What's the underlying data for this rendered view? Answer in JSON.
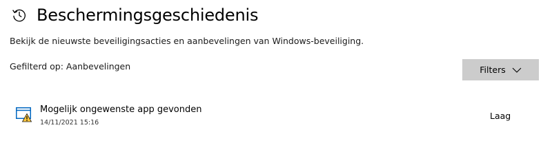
{
  "header": {
    "title": "Beschermingsgeschiedenis",
    "icon": "history-icon"
  },
  "description": "Bekijk de nieuwste beveiligingsacties en aanbevelingen van Windows-beveiliging.",
  "filter": {
    "status": "Gefilterd op: Aanbevelingen",
    "button_label": "Filters",
    "button_icon": "chevron-down-icon"
  },
  "items": [
    {
      "title": "Mogelijk ongewenste app gevonden",
      "date": "14/11/2021 15:16",
      "severity": "Laag",
      "icon": "app-warning-icon"
    }
  ],
  "colors": {
    "button_bg": "#cccccc",
    "icon_blue": "#0067c0",
    "warning_yellow": "#ffc83d"
  }
}
